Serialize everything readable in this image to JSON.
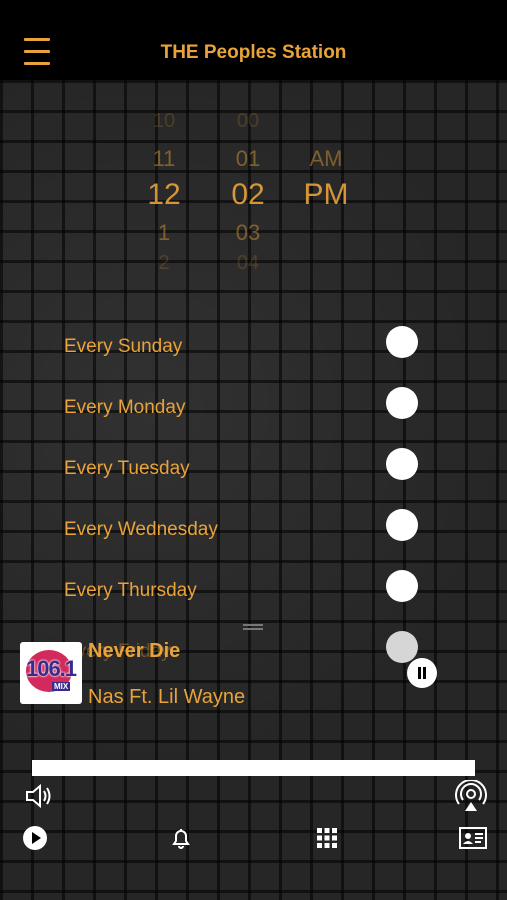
{
  "header": {
    "title": "THE Peoples Station",
    "accent_color": "#e8a33a"
  },
  "time_picker": {
    "hours": [
      "10",
      "11",
      "12",
      "1",
      "2"
    ],
    "minutes": [
      "00",
      "01",
      "02",
      "03",
      "04"
    ],
    "periods": [
      "",
      "AM",
      "PM",
      "",
      ""
    ],
    "selected": {
      "hour": "12",
      "minute": "02",
      "period": "PM"
    }
  },
  "repeat_days": [
    {
      "label": "Every Sunday"
    },
    {
      "label": "Every Monday"
    },
    {
      "label": "Every Tuesday"
    },
    {
      "label": "Every Wednesday"
    },
    {
      "label": "Every Thursday"
    },
    {
      "label": "Every Friday"
    }
  ],
  "player": {
    "song": "Never Die",
    "artist": "Nas Ft. Lil Wayne",
    "logo": {
      "number": "106.1",
      "sub": "MIX"
    },
    "progress": 0
  },
  "icons": {
    "volume": "speaker-icon",
    "airplay": "airplay-icon",
    "play": "play-icon",
    "alarm": "bell-icon",
    "apps": "grid-icon",
    "contact": "contact-card-icon"
  }
}
